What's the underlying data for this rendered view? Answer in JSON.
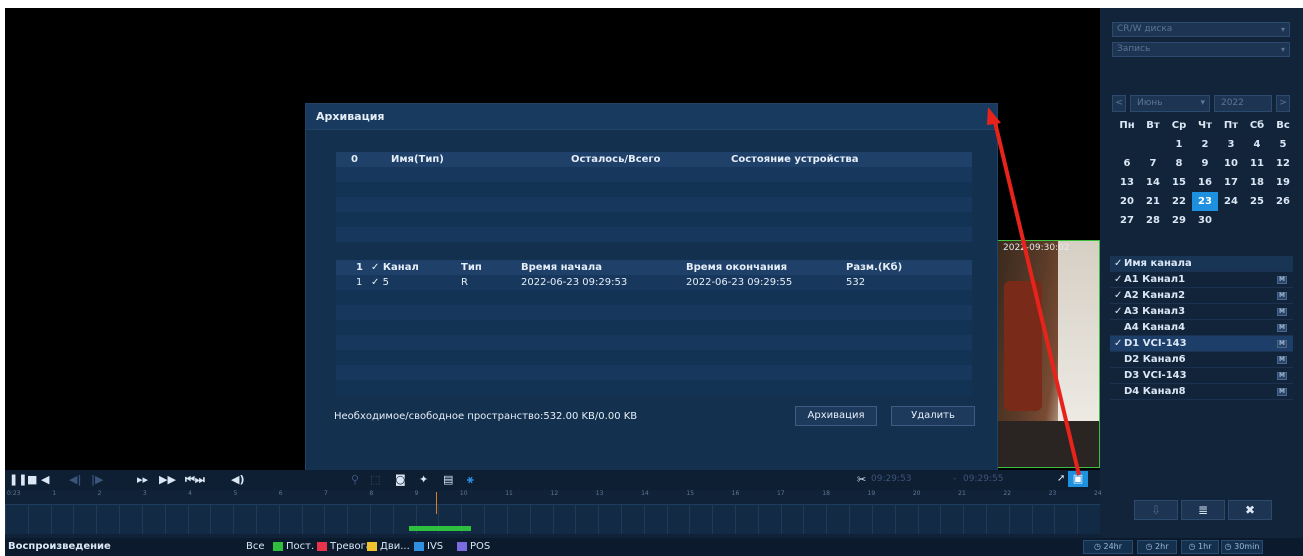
{
  "right_panel": {
    "disk_select": "CR/W диска",
    "type_select": "Запись",
    "calendar": {
      "prev": "<",
      "next": ">",
      "month": "Июнь",
      "year": "2022",
      "weekdays": [
        "Пн",
        "Вт",
        "Ср",
        "Чт",
        "Пт",
        "Сб",
        "Вс"
      ],
      "weeks": [
        [
          "",
          "",
          "1",
          "2",
          "3",
          "4",
          "5"
        ],
        [
          "6",
          "7",
          "8",
          "9",
          "10",
          "11",
          "12"
        ],
        [
          "13",
          "14",
          "15",
          "16",
          "17",
          "18",
          "19"
        ],
        [
          "20",
          "21",
          "22",
          "23",
          "24",
          "25",
          "26"
        ],
        [
          "27",
          "28",
          "29",
          "30",
          "",
          "",
          ""
        ]
      ],
      "selected_day": "23"
    },
    "channel_header": "Имя канала",
    "channels": [
      {
        "name": "A1 Канал1",
        "checked": true
      },
      {
        "name": "A2 Канал2",
        "checked": true
      },
      {
        "name": "A3 Канал3",
        "checked": true
      },
      {
        "name": "A4 Канал4",
        "checked": false
      },
      {
        "name": "D1 VCI-143",
        "checked": true,
        "selected": true
      },
      {
        "name": "D2 Канал6",
        "checked": false
      },
      {
        "name": "D3 VCI-143",
        "checked": false
      },
      {
        "name": "D4 Канал8",
        "checked": false
      }
    ]
  },
  "video": {
    "timestamp": "2022-09:30:02"
  },
  "dialog": {
    "title": "Архивация",
    "device_table": {
      "headers": [
        "0",
        "Имя(Тип)",
        "Осталось/Всего",
        "Состояние устройства"
      ]
    },
    "file_table": {
      "headers": [
        "1",
        "Канал",
        "Тип",
        "Время начала",
        "Время окончания",
        "Разм.(Кб)"
      ],
      "rows": [
        [
          "1",
          "5",
          "R",
          "2022-06-23 09:29:53",
          "2022-06-23 09:29:55",
          "532"
        ]
      ]
    },
    "space_label": "Необходимое/свободное пространство:532.00 KB/0.00 KB",
    "archive_button": "Архивация",
    "delete_button": "Удалить"
  },
  "toolbar": {
    "time_start": "09:29:53",
    "time_end": "09:29:55"
  },
  "timeline": {
    "ticks": [
      "0:23",
      "1",
      "2",
      "3",
      "4",
      "5",
      "6",
      "7",
      "8",
      "9",
      "10",
      "11",
      "12",
      "13",
      "14",
      "15",
      "16",
      "17",
      "18",
      "19",
      "20",
      "21",
      "22",
      "23",
      "24"
    ]
  },
  "statusbar": {
    "mode": "Воспроизведение",
    "legend": [
      {
        "label": "Все",
        "color": "#0b1a2c"
      },
      {
        "label": "Пост.",
        "color": "#2fbf3f"
      },
      {
        "label": "Тревога",
        "color": "#e8334a"
      },
      {
        "label": "Дви...",
        "color": "#f2c12e"
      },
      {
        "label": "IVS",
        "color": "#2f8fe0"
      },
      {
        "label": "POS",
        "color": "#7b6be0"
      }
    ],
    "spans": [
      "24hr",
      "2hr",
      "1hr",
      "30min"
    ]
  },
  "colors": {
    "accent": "#1e90e0",
    "arrow": "#e8231c",
    "record": "#2fbf3f"
  }
}
